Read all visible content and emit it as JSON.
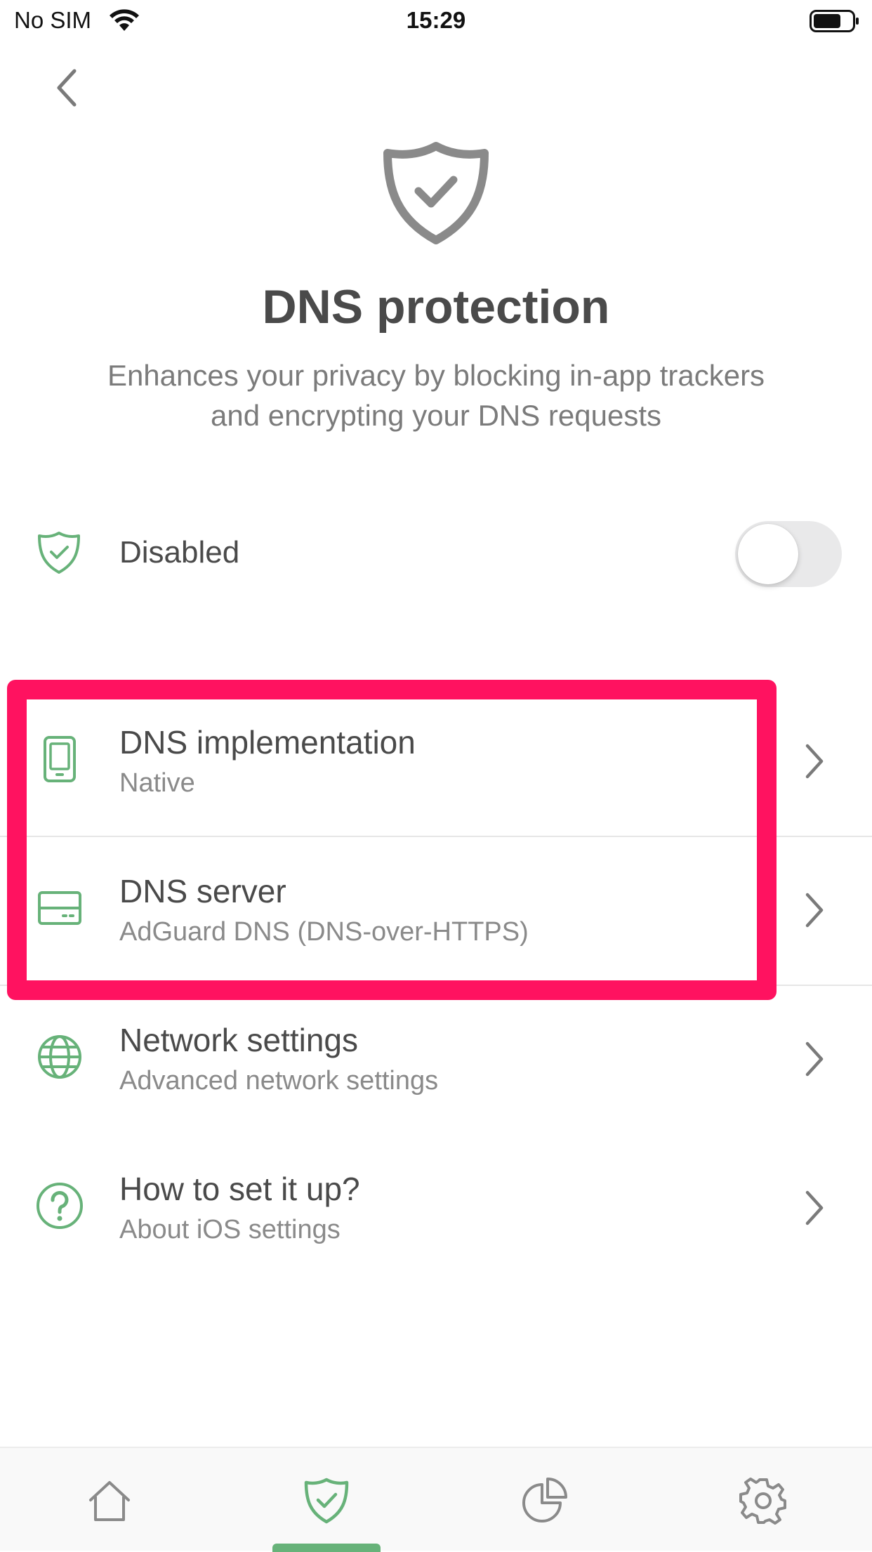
{
  "status_bar": {
    "carrier": "No SIM",
    "time": "15:29"
  },
  "header": {
    "title": "DNS protection",
    "subtitle_line1": "Enhances your privacy by blocking in-app trackers",
    "subtitle_line2": "and encrypting your DNS requests"
  },
  "protection_status": {
    "label": "Disabled",
    "enabled": false
  },
  "menu": {
    "items": [
      {
        "title": "DNS implementation",
        "subtitle": "Native",
        "icon": "phone-icon"
      },
      {
        "title": "DNS server",
        "subtitle": "AdGuard DNS (DNS-over-HTTPS)",
        "icon": "server-icon"
      },
      {
        "title": "Network settings",
        "subtitle": "Advanced network settings",
        "icon": "globe-icon"
      },
      {
        "title": "How to set it up?",
        "subtitle": "About iOS settings",
        "icon": "question-icon"
      }
    ]
  },
  "tab_bar": {
    "tabs": [
      "home-icon",
      "shield-icon",
      "stats-icon",
      "gear-icon"
    ],
    "active_tab": "shield-icon"
  },
  "colors": {
    "accent_green": "#67b279",
    "highlight": "#ff1260",
    "text_primary": "#4a4a4a",
    "text_secondary": "#8a8a8a"
  }
}
